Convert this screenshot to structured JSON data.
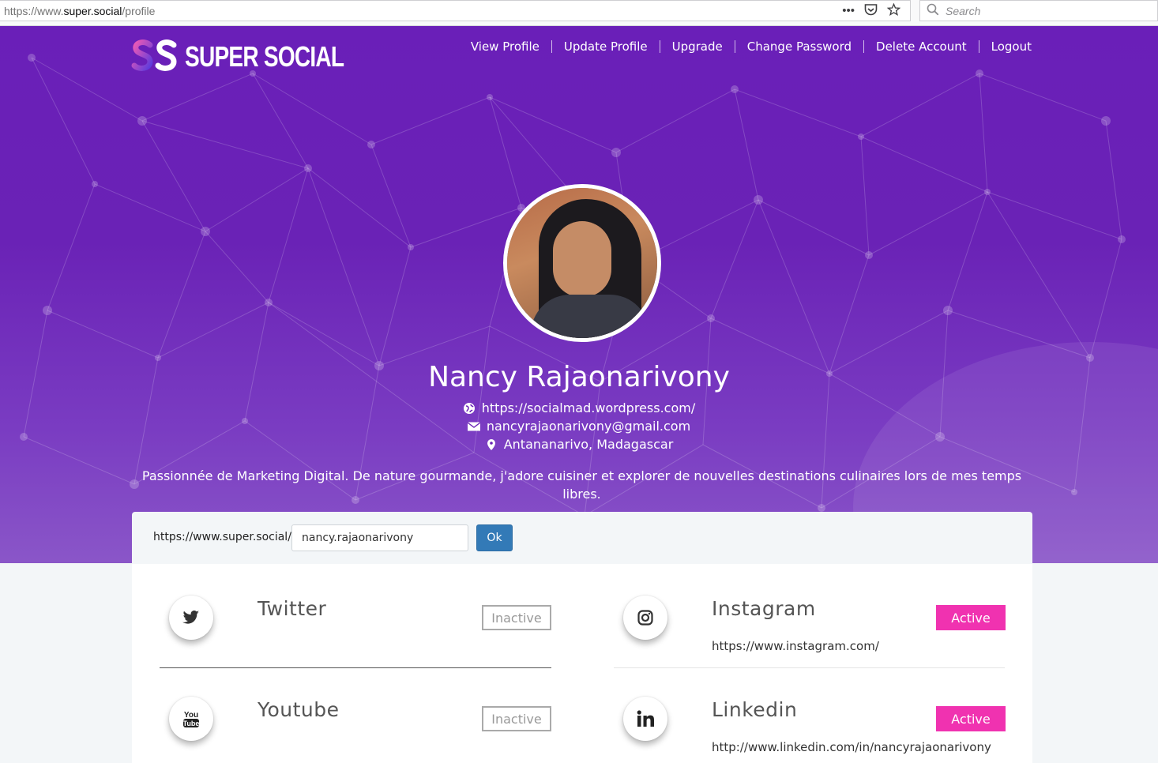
{
  "browser": {
    "url_scheme": "https://www.",
    "url_host": "super.social",
    "url_path": "/profile",
    "search_placeholder": "Search"
  },
  "brand": {
    "name": "SUPER SOCIAL"
  },
  "nav": {
    "items": [
      {
        "label": "View Profile"
      },
      {
        "label": "Update Profile"
      },
      {
        "label": "Upgrade"
      },
      {
        "label": "Change Password"
      },
      {
        "label": "Delete Account"
      },
      {
        "label": "Logout"
      }
    ]
  },
  "profile": {
    "name": "Nancy Rajaonarivony",
    "website": "https://socialmad.wordpress.com/",
    "email": "nancyrajaonarivony@gmail.com",
    "location": "Antananarivo, Madagascar",
    "bio": "Passionnée de Marketing Digital. De nature gourmande, j'adore cuisiner et explorer de nouvelles destinations culinaires lors de mes temps libres."
  },
  "vanity": {
    "prefix": "https://www.super.social/",
    "value": "nancy.rajaonarivony",
    "ok_label": "Ok"
  },
  "networks": [
    {
      "name": "Twitter",
      "status": "Inactive",
      "url": "",
      "icon": "twitter-icon"
    },
    {
      "name": "Instagram",
      "status": "Active",
      "url": "https://www.instagram.com/",
      "icon": "instagram-icon"
    },
    {
      "name": "Youtube",
      "status": "Inactive",
      "url": "",
      "icon": "youtube-icon"
    },
    {
      "name": "Linkedin",
      "status": "Active",
      "url": "http://www.linkedin.com/in/nancyrajaonarivony",
      "icon": "linkedin-icon"
    }
  ],
  "colors": {
    "hero_purple": "#6a1fb8",
    "active_pink": "#f032b0",
    "ok_blue": "#337ab7"
  }
}
